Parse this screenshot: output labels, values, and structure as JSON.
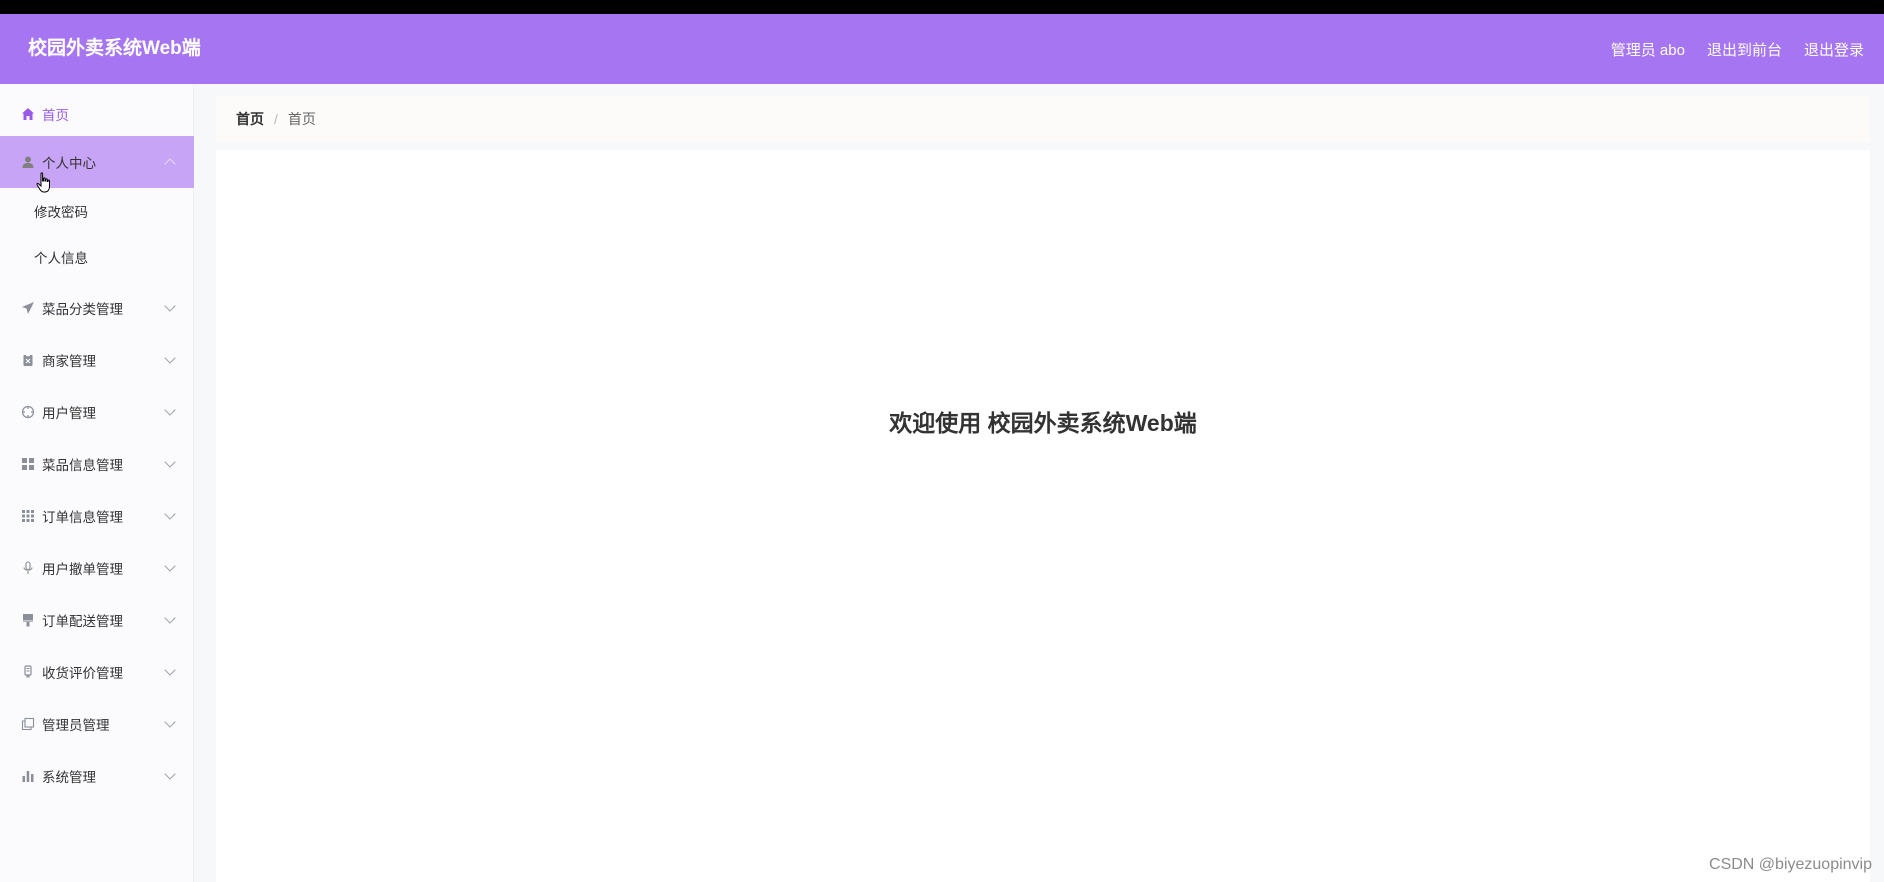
{
  "header": {
    "title": "校园外卖系统Web端",
    "user_label": "管理员 abo",
    "to_frontend": "退出到前台",
    "logout": "退出登录",
    "bg_color": "#a675f2"
  },
  "sidebar": {
    "home": {
      "label": "首页",
      "icon": "home-icon"
    },
    "items": [
      {
        "label": "个人中心",
        "icon": "user-icon",
        "expanded": true
      },
      {
        "label": "菜品分类管理",
        "icon": "send-icon"
      },
      {
        "label": "商家管理",
        "icon": "clipboard-icon"
      },
      {
        "label": "用户管理",
        "icon": "crosshair-icon"
      },
      {
        "label": "菜品信息管理",
        "icon": "grid-icon"
      },
      {
        "label": "订单信息管理",
        "icon": "apps-icon"
      },
      {
        "label": "用户撤单管理",
        "icon": "microphone-icon"
      },
      {
        "label": "订单配送管理",
        "icon": "brush-icon"
      },
      {
        "label": "收货评价管理",
        "icon": "badge-icon"
      },
      {
        "label": "管理员管理",
        "icon": "copy-icon"
      },
      {
        "label": "系统管理",
        "icon": "bar-chart-icon"
      }
    ],
    "sub_items": [
      {
        "label": "修改密码"
      },
      {
        "label": "个人信息"
      }
    ],
    "active_color": "#c8a4f6"
  },
  "breadcrumb": {
    "first": "首页",
    "separator": "/",
    "current": "首页"
  },
  "main": {
    "welcome": "欢迎使用 校园外卖系统Web端"
  },
  "watermark": "CSDN @biyezuopinvip"
}
